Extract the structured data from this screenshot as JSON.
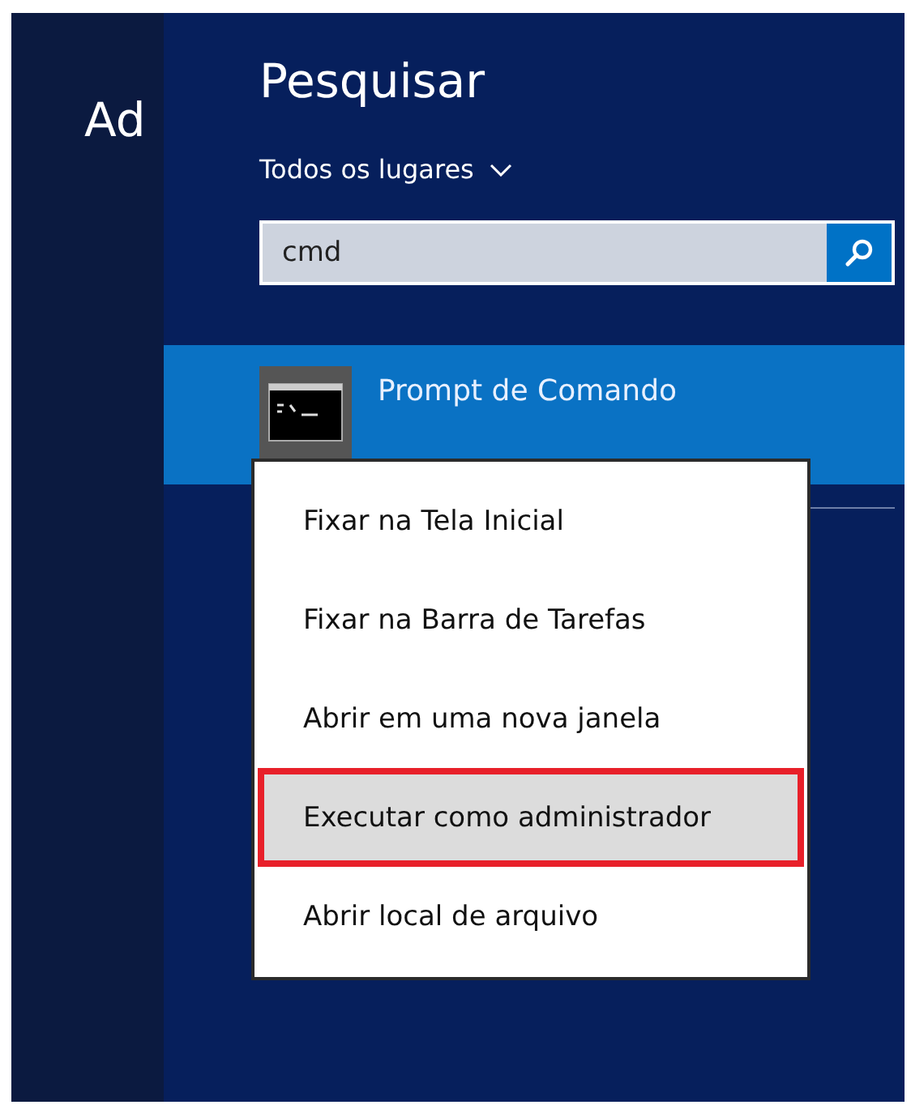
{
  "side_label": "Ad",
  "search": {
    "title": "Pesquisar",
    "scope": "Todos os lugares",
    "value": "cmd"
  },
  "results": [
    {
      "label": "Prompt de Comando",
      "selected": true
    }
  ],
  "context_menu": [
    {
      "label": "Fixar na Tela Inicial",
      "selected": false,
      "marked": false
    },
    {
      "label": "Fixar na Barra de Tarefas",
      "selected": false,
      "marked": false
    },
    {
      "label": "Abrir em uma nova janela",
      "selected": false,
      "marked": false
    },
    {
      "label": "Executar como administrador",
      "selected": true,
      "marked": true
    },
    {
      "label": "Abrir local de arquivo",
      "selected": false,
      "marked": false
    }
  ]
}
